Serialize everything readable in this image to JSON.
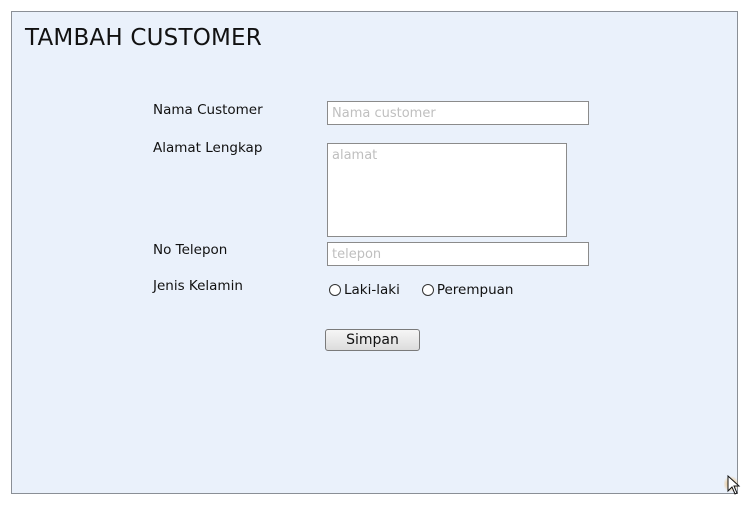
{
  "form": {
    "title": "TAMBAH CUSTOMER",
    "fields": {
      "nama": {
        "label": "Nama Customer",
        "placeholder": "Nama customer",
        "value": ""
      },
      "alamat": {
        "label": "Alamat Lengkap",
        "placeholder": "alamat",
        "value": ""
      },
      "telepon": {
        "label": "No Telepon",
        "placeholder": "telepon",
        "value": ""
      },
      "gender": {
        "label": "Jenis Kelamin",
        "options": [
          "Laki-laki",
          "Perempuan"
        ],
        "selected": null
      }
    },
    "submit_label": "Simpan"
  },
  "colors": {
    "panel_bg": "#eaf1fb",
    "panel_border": "#8a8f96",
    "placeholder": "#bfbfbf",
    "cursor_glow": "#e8a030"
  },
  "icons": {
    "cursor": "mouse-pointer-icon"
  }
}
